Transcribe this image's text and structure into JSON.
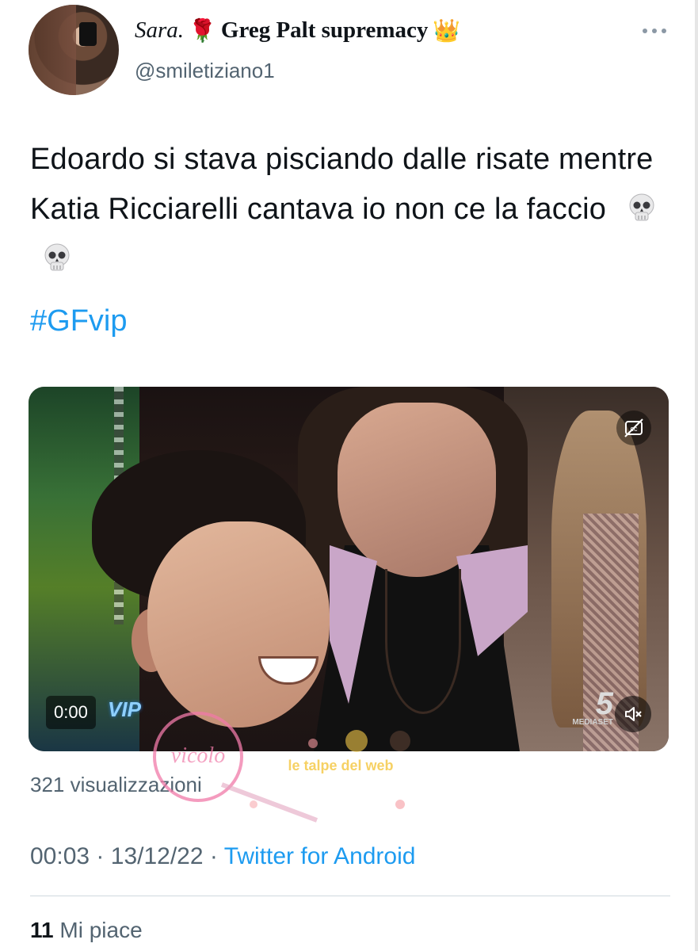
{
  "author": {
    "display_name_prefix": "Sara.",
    "display_name_main": "Greg Palt supremacy",
    "handle": "@smiletiziano1",
    "rose_emoji": "🌹",
    "crown_emoji": "👑"
  },
  "tweet": {
    "text": "Edoardo si stava pisciando dalle risate mentre Katia Ricciarelli cantava io non ce la faccio",
    "hashtag": "#GFvip"
  },
  "video": {
    "timecode": "0:00",
    "show_logo": "VIP",
    "channel_logo": "5",
    "channel_sub": "MEDIASET"
  },
  "stats": {
    "views": "321 visualizzazioni",
    "time": "00:03",
    "date": "13/12/22",
    "separator": "·",
    "source": "Twitter for Android",
    "likes_count": "11",
    "likes_label": "Mi piace"
  },
  "watermark": {
    "left_text": "vicolo delle news",
    "right_text": "le talpe del web"
  },
  "colors": {
    "link": "#1d9bf0",
    "secondary_text": "#536471",
    "primary_text": "#0f1419"
  }
}
